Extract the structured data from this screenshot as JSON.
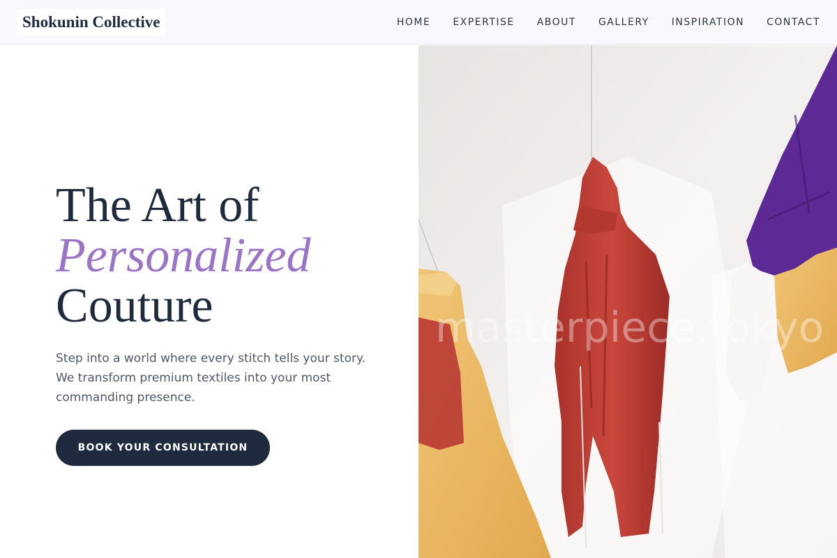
{
  "brand": {
    "name": "Shokunin Collective"
  },
  "nav": {
    "items": [
      {
        "label": "HOME"
      },
      {
        "label": "EXPERTISE"
      },
      {
        "label": "ABOUT"
      },
      {
        "label": "GALLERY"
      },
      {
        "label": "INSPIRATION"
      },
      {
        "label": "CONTACT"
      }
    ]
  },
  "hero": {
    "headline_line1": "The Art of",
    "headline_accent": "Personalized",
    "headline_line3": "Couture",
    "intro": "Step into a world where every stitch tells your story. We transform premium textiles into your most commanding presence.",
    "cta_label": "BOOK YOUR CONSULTATION",
    "image_watermark": "masterpiece.tokyo"
  },
  "colors": {
    "text_dark": "#1f2a3c",
    "accent_purple": "#9a74c6",
    "button_bg": "#1f2a3f",
    "nav_bg": "#faf8fc"
  }
}
